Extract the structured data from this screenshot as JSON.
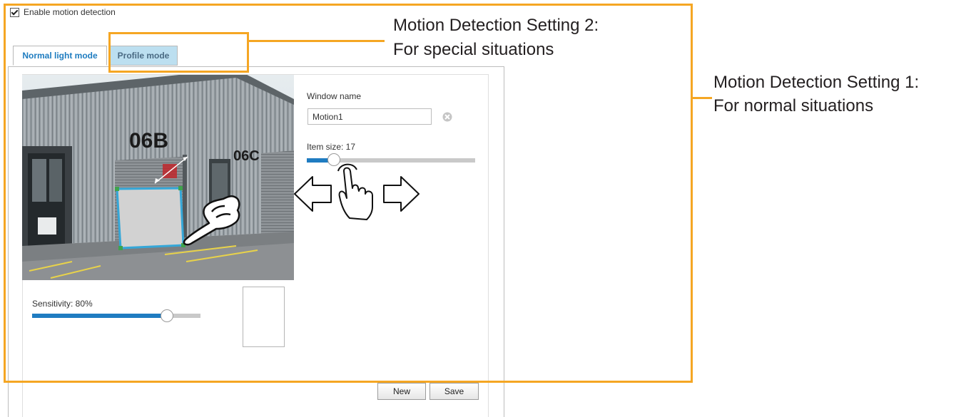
{
  "enable_motion_detection": {
    "label": "Enable motion detection",
    "checked": true
  },
  "tabs": [
    {
      "label": "Normal light mode",
      "active": true
    },
    {
      "label": "Profile mode",
      "active": false
    }
  ],
  "camera": {
    "building_labels": [
      "06B",
      "06C"
    ]
  },
  "window_name": {
    "label": "Window name",
    "value": "Motion1",
    "clear_icon": "clear-x-icon"
  },
  "item_size": {
    "label": "Item size: 17",
    "value": 17,
    "fill_fraction": 0.16
  },
  "sensitivity": {
    "label": "Sensitivity: 80%",
    "value_percent": 80
  },
  "buttons": {
    "new_label": "New",
    "save_label": "Save"
  },
  "annotations": {
    "setting2_line1": "Motion Detection Setting 2:",
    "setting2_line2": "For special situations",
    "setting1_line1": "Motion Detection Setting 1:",
    "setting1_line2": "For normal situations"
  },
  "colors": {
    "annotation": "#f5a623",
    "accent": "#1f7cc1",
    "tab_active_text": "#1e7cc0",
    "tab_inactive_bg": "#bcdff0"
  }
}
